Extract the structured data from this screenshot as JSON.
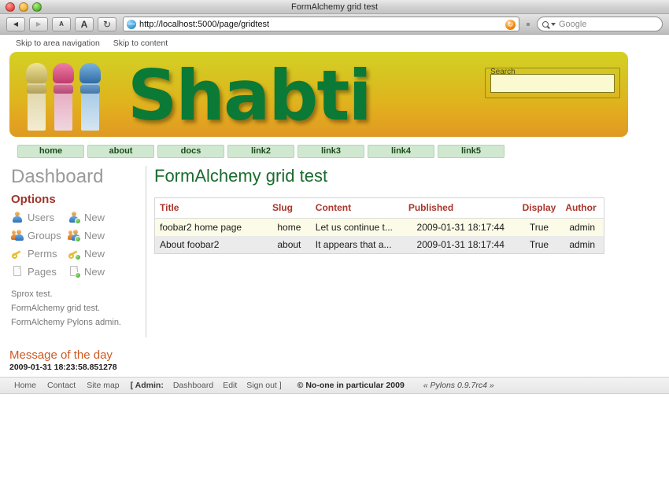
{
  "browser": {
    "window_title": "FormAlchemy grid test",
    "back_label": "◀",
    "forward_label": "▶",
    "text_smaller_label": "A",
    "text_larger_label": "A",
    "reload_label": "↻",
    "url": "http://localhost:5000/page/gridtest",
    "stop_reload_label": "↻",
    "search_placeholder": "Google",
    "traffic_lights": [
      "close",
      "minimize",
      "zoom"
    ]
  },
  "skiplinks": [
    {
      "label": "Skip to area navigation"
    },
    {
      "label": "Skip to content"
    }
  ],
  "banner": {
    "site_title": "Shabti",
    "gradient_top": "#d4d123",
    "gradient_bottom": "#dd9a22",
    "title_color": "#0b7a36",
    "figurines": [
      {
        "name": "shabti-figure-yellow",
        "color": "#ded2a0"
      },
      {
        "name": "shabti-figure-pink",
        "color": "#e4a2ba"
      },
      {
        "name": "shabti-figure-blue",
        "color": "#9cc3e2"
      }
    ],
    "search": {
      "legend": "Search",
      "value": "",
      "placeholder": ""
    }
  },
  "nav": {
    "tabs": [
      {
        "label": "home"
      },
      {
        "label": "about"
      },
      {
        "label": "docs"
      },
      {
        "label": "link2"
      },
      {
        "label": "link3"
      },
      {
        "label": "link4"
      },
      {
        "label": "link5"
      }
    ]
  },
  "sidebar": {
    "heading": "Dashboard",
    "options_heading": "Options",
    "options": [
      {
        "icon": "user-icon",
        "label": "Users",
        "new_icon": "user-add-icon",
        "new_label": "New"
      },
      {
        "icon": "group-icon",
        "label": "Groups",
        "new_icon": "group-add-icon",
        "new_label": "New"
      },
      {
        "icon": "key-icon",
        "label": "Perms",
        "new_icon": "key-add-icon",
        "new_label": "New"
      },
      {
        "icon": "page-icon",
        "label": "Pages",
        "new_icon": "page-add-icon",
        "new_label": "New"
      }
    ],
    "links": [
      {
        "label": "Sprox test."
      },
      {
        "label": "FormAlchemy grid test."
      },
      {
        "label": "FormAlchemy Pylons admin."
      }
    ]
  },
  "main": {
    "heading": "FormAlchemy grid test",
    "table": {
      "columns": [
        "Title",
        "Slug",
        "Content",
        "Published",
        "Display",
        "Author"
      ],
      "rows": [
        {
          "title": "foobar2 home page",
          "slug": "home",
          "content": "Let us continue t...",
          "published": "2009-01-31 18:17:44",
          "display": "True",
          "author": "admin"
        },
        {
          "title": "About foobar2",
          "slug": "about",
          "content": "It appears that a...",
          "published": "2009-01-31 18:17:44",
          "display": "True",
          "author": "admin"
        }
      ]
    }
  },
  "motd": {
    "heading": "Message of the day",
    "timestamp": "2009-01-31 18:23:58.851278"
  },
  "footer": {
    "links": [
      {
        "label": "Home"
      },
      {
        "label": "Contact"
      },
      {
        "label": "Site map"
      }
    ],
    "admin_open": "[ Admin:",
    "admin_links": [
      {
        "label": "Dashboard"
      },
      {
        "label": "Edit"
      },
      {
        "label": "Sign out ]"
      }
    ],
    "copyright": "© No-one in particular 2009",
    "powered_by": "« Pylons 0.9.7rc4 »"
  }
}
